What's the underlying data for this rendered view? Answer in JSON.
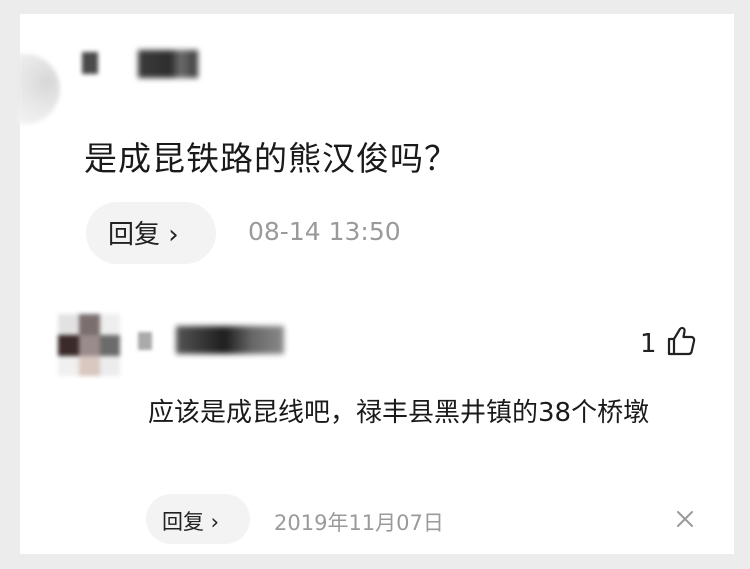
{
  "top_comment": {
    "question": "是成昆铁路的熊汉俊吗？",
    "reply_label": "回复 ›",
    "time": "08-14 13:50"
  },
  "reply_comment": {
    "like_count": "1",
    "text": "应该是成昆线吧，禄丰县黑井镇的38个桥墩",
    "reply_label": "回复 ›",
    "time": "2019年11月07日"
  },
  "icons": {
    "like": "thumbs-up-icon",
    "close": "close-icon"
  },
  "colors": {
    "background": "#ececec",
    "card": "#ffffff",
    "text": "#1a1a1a",
    "muted": "#9a9a9a",
    "pill": "#f3f3f3"
  }
}
